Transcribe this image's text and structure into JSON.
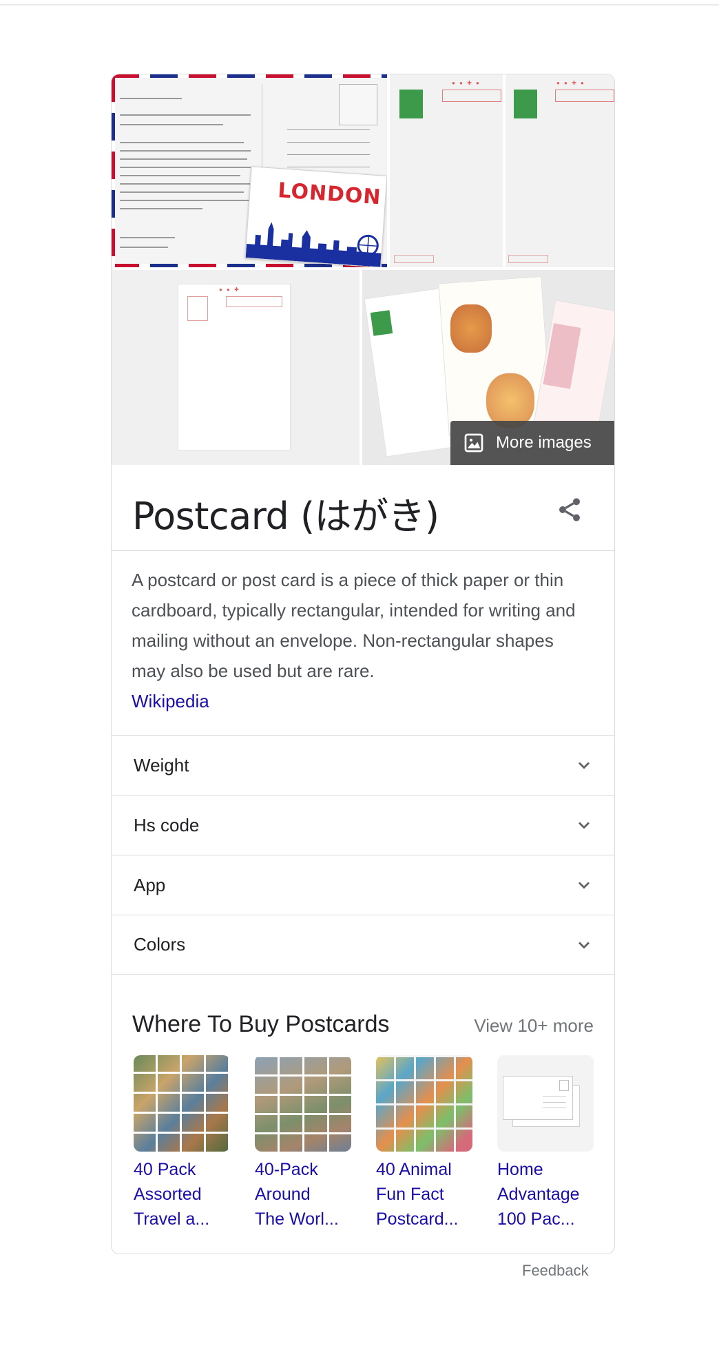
{
  "panel": {
    "more_images_label": "More images",
    "title": "Postcard (はがき)",
    "description": "A postcard or post card is a piece of thick paper or thin cardboard, typically rectangular, intended for writing and mailing without an envelope. Non-rectangular shapes may also be used but are rare.",
    "source_link": "Wikipedia"
  },
  "attributes": [
    {
      "label": "Weight"
    },
    {
      "label": "Hs code"
    },
    {
      "label": "App"
    },
    {
      "label": "Colors"
    }
  ],
  "where_to_buy": {
    "title": "Where To Buy Postcards",
    "view_more": "View 10+ more",
    "products": [
      {
        "line1": "40 Pack",
        "line2": "Assorted",
        "line3": "Travel a..."
      },
      {
        "line1": "40-Pack",
        "line2": "Around",
        "line3": "The Worl..."
      },
      {
        "line1": "40 Animal",
        "line2": "Fun Fact",
        "line3": "Postcard..."
      },
      {
        "line1": "Home",
        "line2": "Advantage",
        "line3": "100 Pac..."
      }
    ]
  },
  "postcard_letter": {
    "london_word": "LONDON"
  },
  "footer": {
    "feedback": "Feedback"
  },
  "colors": {
    "link": "#1a0dab",
    "border": "#dadce0",
    "muted": "#70757a"
  }
}
